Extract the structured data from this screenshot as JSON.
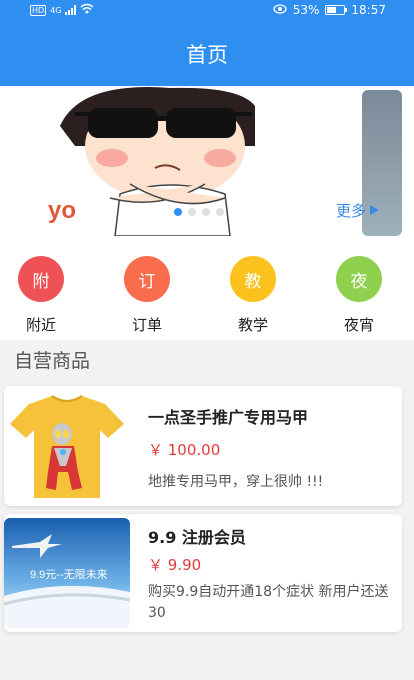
{
  "status_bar": {
    "network_badge": "HD",
    "network_type": "4G",
    "battery": "53%",
    "time": "18:57"
  },
  "app_bar": {
    "title": "首页"
  },
  "banner": {
    "more_label": "更多",
    "slide_count": 4,
    "active_index": 0
  },
  "quick_menu": [
    {
      "icon_char": "附",
      "label": "附近",
      "color": "#ef5256"
    },
    {
      "icon_char": "订",
      "label": "订单",
      "color": "#f96c4c"
    },
    {
      "icon_char": "教",
      "label": "教学",
      "color": "#fbc21e"
    },
    {
      "icon_char": "夜",
      "label": "夜宵",
      "color": "#8fd14f"
    }
  ],
  "section": {
    "title": "自营商品"
  },
  "products": [
    {
      "title": "一点圣手推广专用马甲",
      "price": "￥ 100.00",
      "description": "地推专用马甲，穿上很帅 !!!"
    },
    {
      "title": "9.9 注册会员",
      "price": "￥ 9.90",
      "description": "购买9.9自动开通18个症状 新用户还送30",
      "image_text": "9.9元--无限未来"
    }
  ]
}
